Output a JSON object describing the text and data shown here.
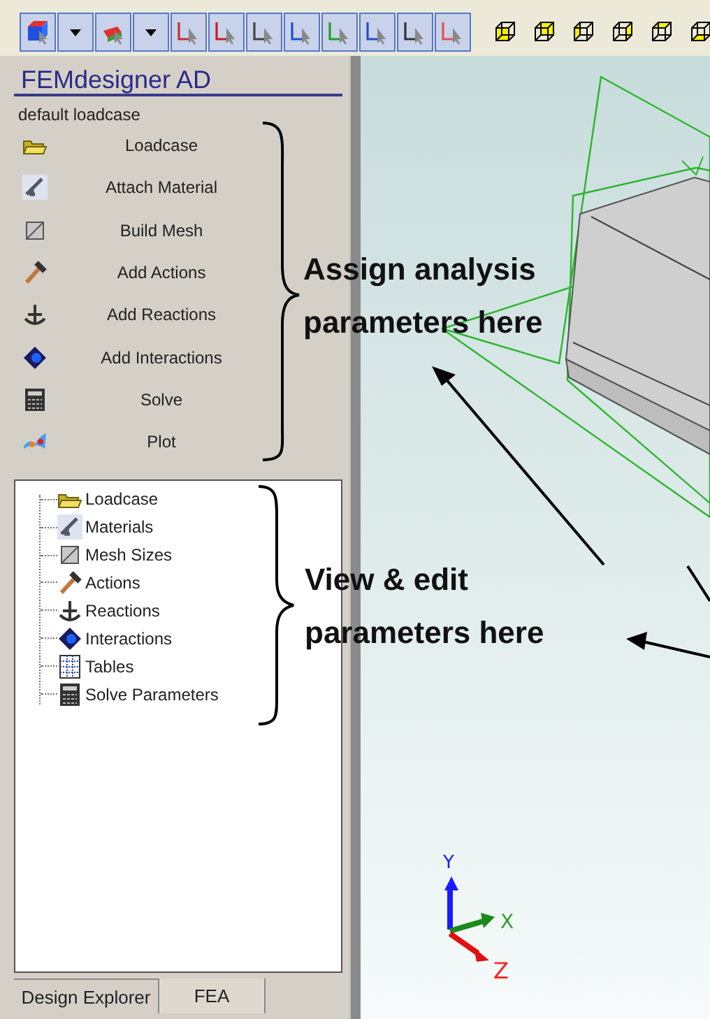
{
  "panel": {
    "title": "FEMdesigner AD",
    "subtitle": "default loadcase",
    "actions": [
      {
        "label": "Loadcase"
      },
      {
        "label": "Attach Material"
      },
      {
        "label": "Build Mesh"
      },
      {
        "label": "Add Actions"
      },
      {
        "label": "Add Reactions"
      },
      {
        "label": "Add Interactions"
      },
      {
        "label": "Solve"
      },
      {
        "label": "Plot"
      }
    ],
    "tree": [
      {
        "label": "Loadcase"
      },
      {
        "label": "Materials"
      },
      {
        "label": "Mesh Sizes"
      },
      {
        "label": "Actions"
      },
      {
        "label": "Reactions"
      },
      {
        "label": "Interactions"
      },
      {
        "label": "Tables"
      },
      {
        "label": "Solve Parameters"
      }
    ],
    "tabs": [
      {
        "label": "Design Explorer",
        "selected": false
      },
      {
        "label": "FEA",
        "selected": true
      }
    ]
  },
  "viewport": {
    "axis_labels": {
      "x": "X",
      "y": "Y",
      "z": "Z"
    }
  },
  "annotations": [
    {
      "text": "Assign analysis parameters here"
    },
    {
      "text": "View & edit parameters here"
    }
  ]
}
